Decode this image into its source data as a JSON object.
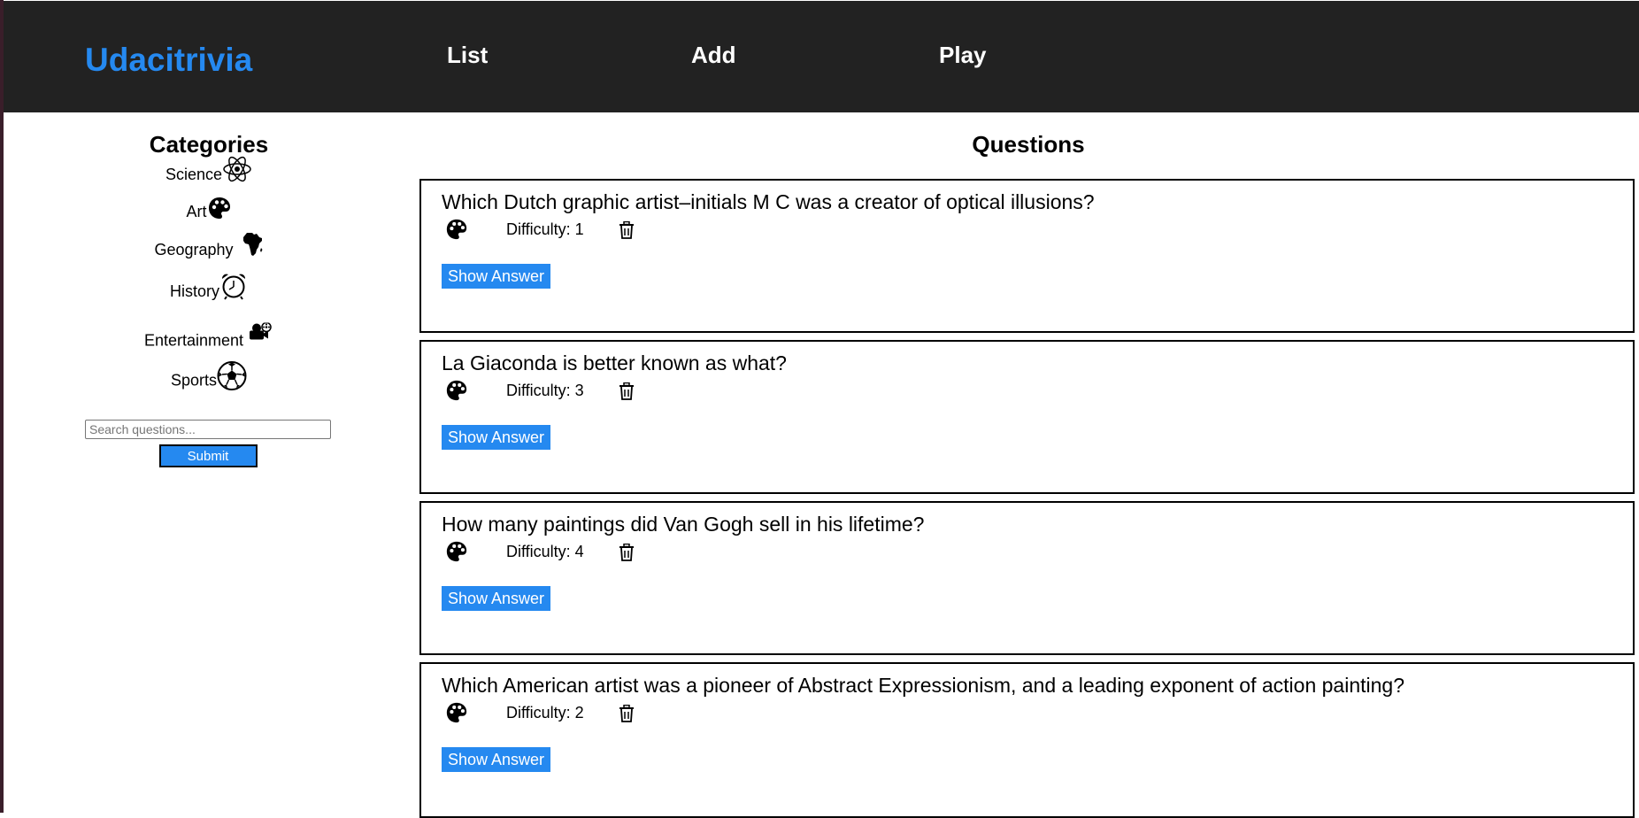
{
  "header": {
    "brand": "Udacitrivia",
    "nav": {
      "list": "List",
      "add": "Add",
      "play": "Play"
    }
  },
  "sidebar": {
    "title": "Categories",
    "categories": [
      {
        "label": "Science",
        "icon": "atom-icon"
      },
      {
        "label": "Art",
        "icon": "palette-icon"
      },
      {
        "label": "Geography",
        "icon": "africa-map-icon"
      },
      {
        "label": "History",
        "icon": "alarm-clock-icon"
      },
      {
        "label": "Entertainment",
        "icon": "film-camera-icon"
      },
      {
        "label": "Sports",
        "icon": "soccer-ball-icon"
      }
    ],
    "search": {
      "placeholder": "Search questions...",
      "value": ""
    },
    "submit_label": "Submit"
  },
  "main": {
    "title": "Questions",
    "questions": [
      {
        "text": "Which Dutch graphic artist–initials M C was a creator of optical illusions?",
        "category_icon": "palette-icon",
        "difficulty": "Difficulty: 1",
        "show_answer_label": "Show Answer"
      },
      {
        "text": "La Giaconda is better known as what?",
        "category_icon": "palette-icon",
        "difficulty": "Difficulty: 3",
        "show_answer_label": "Show Answer"
      },
      {
        "text": "How many paintings did Van Gogh sell in his lifetime?",
        "category_icon": "palette-icon",
        "difficulty": "Difficulty: 4",
        "show_answer_label": "Show Answer"
      },
      {
        "text": "Which American artist was a pioneer of Abstract Expressionism, and a leading exponent of action painting?",
        "category_icon": "palette-icon",
        "difficulty": "Difficulty: 2",
        "show_answer_label": "Show Answer"
      }
    ]
  },
  "colors": {
    "header_bg": "#222222",
    "brand": "#2589f0",
    "button_bg": "#2589f0"
  }
}
